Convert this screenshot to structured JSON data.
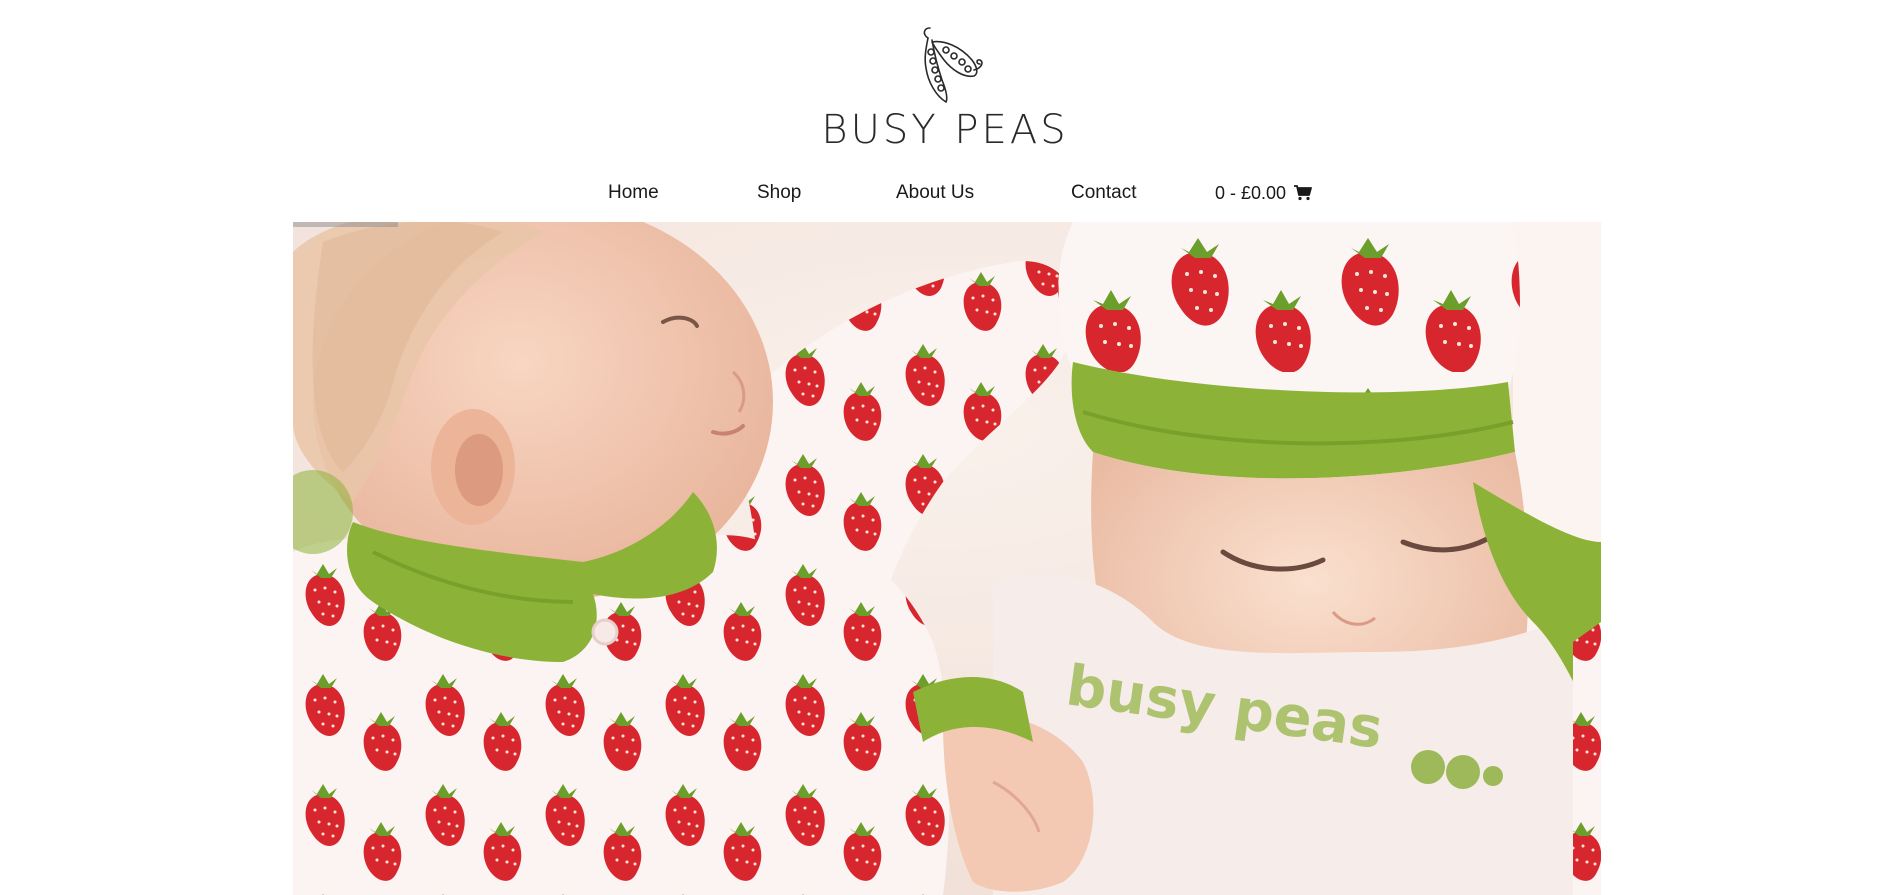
{
  "brand": {
    "name": "BUSY PEAS",
    "logo_icon": "pea-pod-icon"
  },
  "nav": {
    "items": [
      {
        "label": "Home"
      },
      {
        "label": "Shop"
      },
      {
        "label": "About Us"
      },
      {
        "label": "Contact"
      }
    ],
    "cart": {
      "label": "0 - £0.00",
      "icon": "shopping-cart-icon"
    }
  },
  "hero": {
    "image_text": "busy peas",
    "slide_progress": 0.08
  },
  "colors": {
    "background": "#ffffff",
    "text": "#1a1a1a",
    "accent_green": "#8cb338",
    "strawberry_red": "#d8262f"
  }
}
